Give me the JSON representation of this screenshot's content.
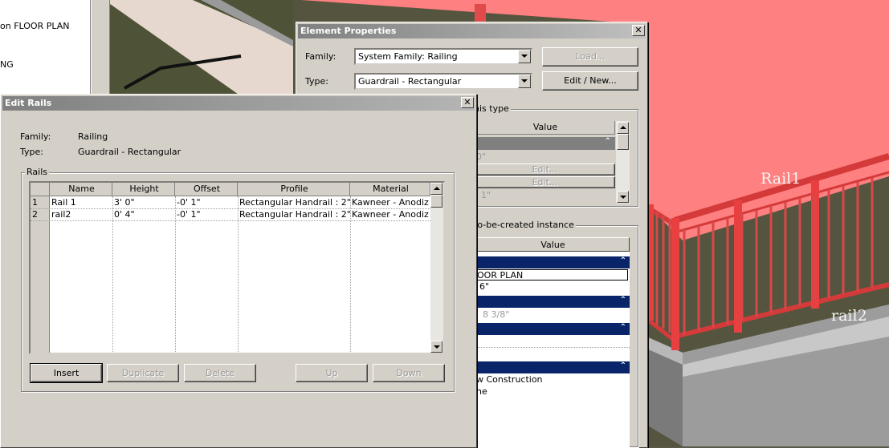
{
  "project_browser": {
    "items": [
      "on FLOOR PLAN",
      "NG"
    ]
  },
  "viewport": {
    "rail_labels": [
      "Rail1",
      "rail2"
    ]
  },
  "element_properties": {
    "title": "Element Properties",
    "family_label": "Family:",
    "family_value": "System Family: Railing",
    "type_label": "Type:",
    "type_value": "Guardrail - Rectangular",
    "load_button": "Load...",
    "edit_new_button": "Edit / New...",
    "type_params_legend": "his type",
    "type_params_value_header": "Value",
    "type_rows": [
      "0\"",
      "Edit...",
      "Edit...",
      "1\""
    ],
    "instance_legend": "to-be-created instance",
    "instance_value_header": "Value",
    "instance_rows": [
      "OOR PLAN",
      "6\"",
      "8 3/8\"",
      "w Construction",
      "ne"
    ]
  },
  "edit_rails": {
    "title": "Edit Rails",
    "family_label": "Family:",
    "family_value": "Railing",
    "type_label": "Type:",
    "type_value": "Guardrail - Rectangular",
    "rails_legend": "Rails",
    "columns": [
      "Name",
      "Height",
      "Offset",
      "Profile",
      "Material"
    ],
    "rows": [
      {
        "num": "1",
        "name": "Rail 1",
        "height": "3'  0\"",
        "offset": "-0'  1\"",
        "profile": "Rectangular Handrail : 2\"",
        "material": "Kawneer - Anodiz"
      },
      {
        "num": "2",
        "name": "rail2",
        "height": "0'  4\"",
        "offset": "-0'  1\"",
        "profile": "Rectangular Handrail : 2\"",
        "material": "Kawneer - Anodiz"
      }
    ],
    "buttons": {
      "insert": "Insert",
      "duplicate": "Duplicate",
      "delete": "Delete",
      "up": "Up",
      "down": "Down"
    }
  },
  "colors": {
    "roof": "#ff8080",
    "railing": "#e84040",
    "titlebar_band": "#0a246a",
    "dialog_face": "#d4d0c8"
  }
}
